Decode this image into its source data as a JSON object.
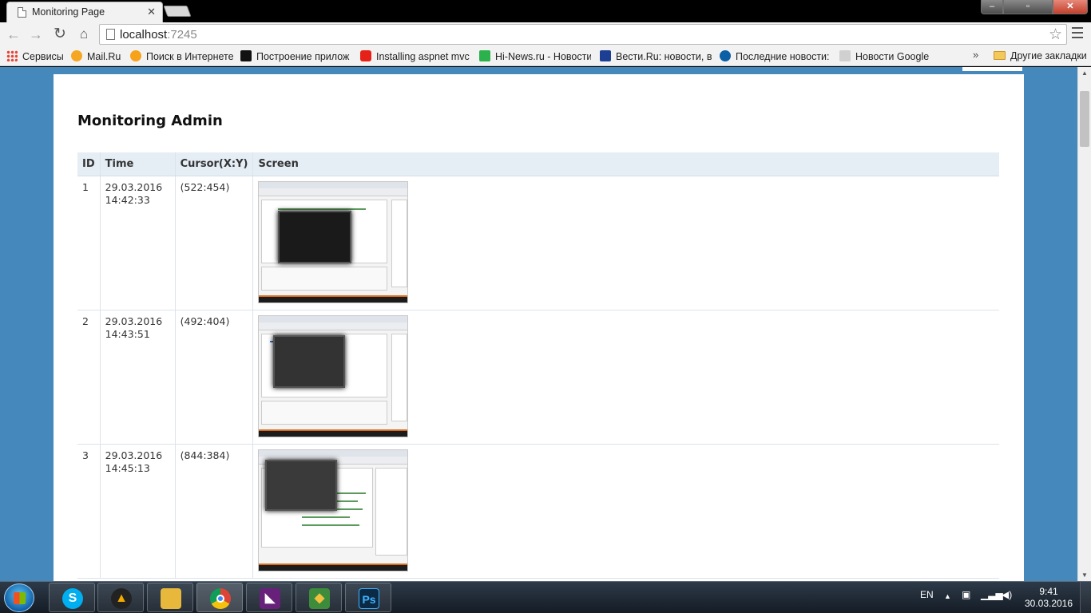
{
  "browser": {
    "tab_title": "Monitoring Page",
    "tab_close": "✕",
    "url_host": "localhost",
    "url_port": ":7245",
    "bookmarks": [
      {
        "label": "Сервисы",
        "color": "#e94235"
      },
      {
        "label": "Mail.Ru",
        "color": "#168de2"
      },
      {
        "label": "Поиск в Интернете",
        "color": "#f6a21b"
      },
      {
        "label": "Построение прилож",
        "color": "#111111"
      },
      {
        "label": "Installing aspnet mvc",
        "color": "#e62117"
      },
      {
        "label": "Hi-News.ru - Новости",
        "color": "#2bb24c"
      },
      {
        "label": "Вести.Ru: новости, ви",
        "color": "#1c3f94"
      },
      {
        "label": "Последние новости:",
        "color": "#0b5fa5"
      },
      {
        "label": "Новости Google",
        "color": "#9b9b9b"
      }
    ],
    "bookmarks_more": "»",
    "other_bookmarks": "Другие закладки"
  },
  "page": {
    "title": "Monitoring Admin",
    "columns": [
      "ID",
      "Time",
      "Cursor(X:Y)",
      "Screen"
    ],
    "rows": [
      {
        "id": "1",
        "date": "29.03.2016",
        "time": "14:42:33",
        "cursor": "(522:454)"
      },
      {
        "id": "2",
        "date": "29.03.2016",
        "time": "14:43:51",
        "cursor": "(492:404)"
      },
      {
        "id": "3",
        "date": "29.03.2016",
        "time": "14:45:13",
        "cursor": "(844:384)"
      }
    ]
  },
  "taskbar": {
    "apps": [
      {
        "name": "skype",
        "glyph": "S",
        "color": "#00aff0"
      },
      {
        "name": "aimp",
        "glyph": "▲",
        "color": "#1a1a1a"
      },
      {
        "name": "explorer",
        "glyph": "",
        "color": "#e8b83c"
      },
      {
        "name": "chrome",
        "glyph": "",
        "color": "#db4437"
      },
      {
        "name": "visual-studio",
        "glyph": "◣",
        "color": "#68217a"
      },
      {
        "name": "git-extensions",
        "glyph": "◆",
        "color": "#3c8c3c"
      },
      {
        "name": "photoshop",
        "glyph": "Ps",
        "color": "#0b2a45"
      }
    ],
    "language": "EN",
    "clock_time": "9:41",
    "clock_date": "30.03.2016"
  }
}
